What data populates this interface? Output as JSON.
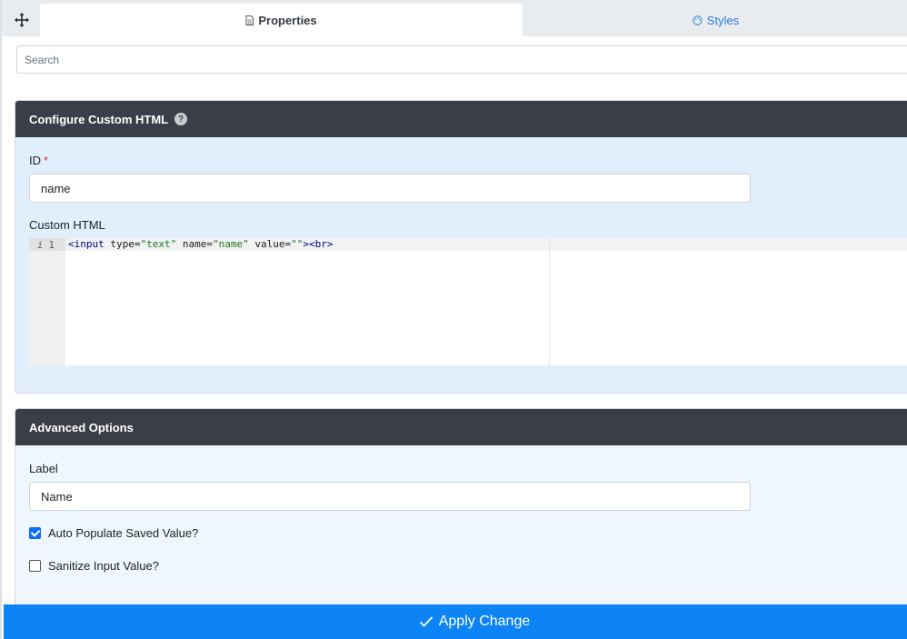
{
  "tabs": [
    {
      "label": "Properties",
      "icon": "document-icon",
      "active": true
    },
    {
      "label": "Styles",
      "icon": "palette-icon",
      "active": false
    }
  ],
  "search": {
    "placeholder": "Search",
    "value": ""
  },
  "custom_html_panel": {
    "title": "Configure Custom HTML",
    "id_label": "ID",
    "required_mark": "*",
    "id_value": "name",
    "custom_html_label": "Custom HTML",
    "editor": {
      "line_number": "1",
      "info_marker": "i",
      "code": {
        "t1": "<input",
        "t2": " type=",
        "t3": "\"text\"",
        "t4": " name=",
        "t5": "\"name\"",
        "t6": " value=",
        "t7": "\"\"",
        "t8": "><br>"
      }
    }
  },
  "advanced_panel": {
    "title": "Advanced Options",
    "label_label": "Label",
    "label_value": "Name",
    "auto_populate": {
      "label": "Auto Populate Saved Value?",
      "checked": true
    },
    "sanitize": {
      "label": "Sanitize Input Value?",
      "checked": false
    }
  },
  "footer": {
    "apply_label": "Apply Change"
  },
  "colors": {
    "header_dark": "#3a3f47",
    "accent_blue": "#0d84f6",
    "panel_blue": "#e1eefc",
    "required_red": "#dc3545"
  }
}
